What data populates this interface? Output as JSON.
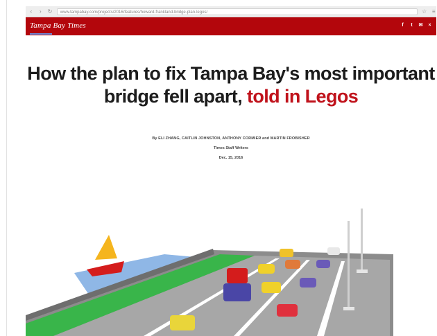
{
  "browser": {
    "url": "www.tampabay.com/projects/2016/features/howard-frankland-bridge-plan-legos/"
  },
  "site": {
    "name": "Tampa Bay Times"
  },
  "social_icons": [
    "facebook-icon",
    "twitter-icon",
    "mail-icon",
    "close-icon"
  ],
  "article": {
    "title_main": "How the plan to fix Tampa Bay's most important bridge fell apart, ",
    "title_accent": "told in Legos",
    "byline": "By ELI ZHANG, CAITLIN JOHNSTON, ANTHONY CORMIER and MARTIN FROBISHER",
    "role": "Times Staff Writers",
    "date": "Dec. 15, 2016"
  },
  "colors": {
    "brand": "#b3060c",
    "accent_text": "#c0121b",
    "grass": "#39b54a",
    "water": "#8fb7e6",
    "road": "#9a9a9a"
  }
}
